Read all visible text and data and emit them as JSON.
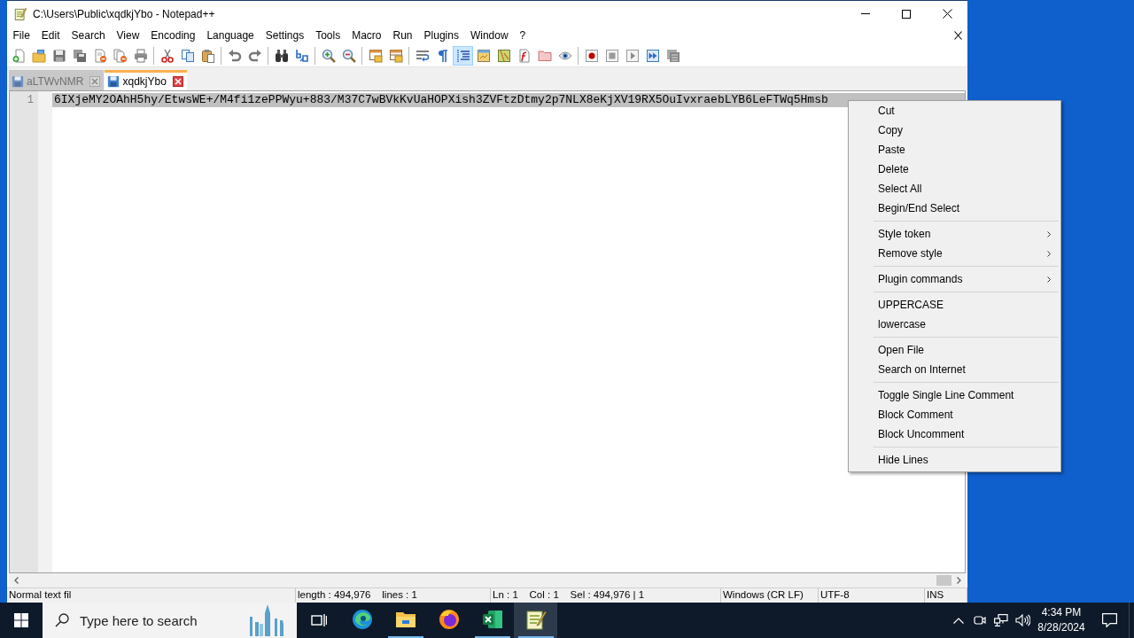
{
  "window": {
    "title": "C:\\Users\\Public\\xqdkjYbo - Notepad++"
  },
  "menu_bar": [
    "File",
    "Edit",
    "Search",
    "View",
    "Encoding",
    "Language",
    "Settings",
    "Tools",
    "Macro",
    "Run",
    "Plugins",
    "Window",
    "?"
  ],
  "toolbar": {
    "groups": [
      {
        "buttons": [
          {
            "pressed": false
          },
          {
            "pressed": false
          },
          {
            "pressed": false
          },
          {
            "pressed": false
          },
          {
            "pressed": false
          },
          {
            "pressed": false
          },
          {
            "pressed": false
          }
        ]
      },
      {
        "buttons": [
          {
            "pressed": false
          },
          {
            "pressed": false
          },
          {
            "pressed": false
          }
        ]
      },
      {
        "buttons": [
          {
            "pressed": false
          },
          {
            "pressed": false
          }
        ]
      },
      {
        "buttons": [
          {
            "pressed": false
          },
          {
            "pressed": false
          }
        ]
      },
      {
        "buttons": [
          {
            "pressed": false
          },
          {
            "pressed": false
          }
        ]
      },
      {
        "buttons": [
          {
            "pressed": false
          },
          {
            "pressed": false
          }
        ]
      },
      {
        "buttons": [
          {
            "pressed": false
          },
          {
            "pressed": false
          },
          {
            "pressed": true
          },
          {
            "pressed": false
          },
          {
            "pressed": false
          },
          {
            "pressed": false
          },
          {
            "pressed": false
          },
          {
            "pressed": false
          }
        ]
      },
      {
        "buttons": [
          {
            "pressed": false
          },
          {
            "pressed": false
          },
          {
            "pressed": false
          },
          {
            "pressed": false
          },
          {
            "pressed": false
          }
        ]
      }
    ]
  },
  "tabs": [
    {
      "label": "aLTWvNMR",
      "selected": false
    },
    {
      "label": "xqdkjYbo",
      "selected": true
    }
  ],
  "editor": {
    "lines": [
      {
        "number": "1",
        "text": "6IXjeMY2OAhH5hy/EtwsWE+/M4fi1zePPWyu+883/M37C7wBVkKvUaHOPXish3ZVFtzDtmy2p7NLX8eKjXV19RX5OuIvxraebLYB6LeFTWq5Hmsb",
        "selected": true
      }
    ]
  },
  "status_bar": [
    "Normal text fil",
    "length : 494,976    lines : 1",
    "Ln : 1    Col : 1    Sel : 494,976 | 1",
    "Windows (CR LF)",
    "UTF-8",
    "INS"
  ],
  "context_menu": {
    "groups": [
      {
        "items": [
          {
            "label": "Cut",
            "submenu": false
          },
          {
            "label": "Copy",
            "submenu": false
          },
          {
            "label": "Paste",
            "submenu": false
          },
          {
            "label": "Delete",
            "submenu": false
          },
          {
            "label": "Select All",
            "submenu": false
          },
          {
            "label": "Begin/End Select",
            "submenu": false
          }
        ]
      },
      {
        "items": [
          {
            "label": "Style token",
            "submenu": true
          },
          {
            "label": "Remove style",
            "submenu": true
          }
        ]
      },
      {
        "items": [
          {
            "label": "Plugin commands",
            "submenu": true
          }
        ]
      },
      {
        "items": [
          {
            "label": "UPPERCASE",
            "submenu": false
          },
          {
            "label": "lowercase",
            "submenu": false
          }
        ]
      },
      {
        "items": [
          {
            "label": "Open File",
            "submenu": false
          },
          {
            "label": "Search on Internet",
            "submenu": false
          }
        ]
      },
      {
        "items": [
          {
            "label": "Toggle Single Line Comment",
            "submenu": false
          },
          {
            "label": "Block Comment",
            "submenu": false
          },
          {
            "label": "Block Uncomment",
            "submenu": false
          }
        ]
      },
      {
        "items": [
          {
            "label": "Hide Lines",
            "submenu": false
          }
        ]
      }
    ]
  },
  "taskbar": {
    "search": {
      "placeholder": "Type here to search"
    },
    "apps": [
      {
        "running": false,
        "selected": false
      },
      {
        "running": true,
        "selected": false
      },
      {
        "running": false,
        "selected": false
      },
      {
        "running": true,
        "selected": false
      },
      {
        "running": true,
        "selected": true
      }
    ],
    "clock": {
      "time": "4:34 PM",
      "date": "8/28/2024"
    }
  }
}
